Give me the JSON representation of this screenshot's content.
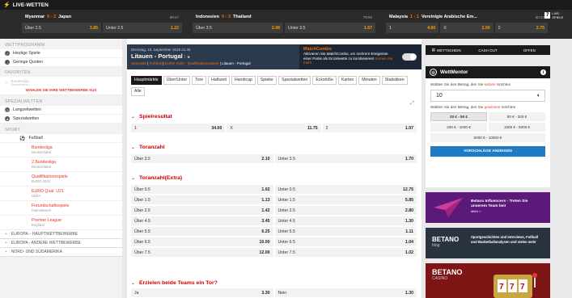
{
  "topbar": {
    "title": "LIVE-WETTEN",
    "live_label": "LIVE-SPIELE",
    "live_count": "7"
  },
  "live_games": [
    {
      "home": "Myanmar",
      "score": "0 - 2",
      "away": "Japan",
      "time": "89:47",
      "odds": [
        {
          "label": "Über 2.5",
          "value": "3.85"
        },
        {
          "label": "Unter 2.5",
          "value": "1.22"
        }
      ]
    },
    {
      "home": "Indonesien",
      "score": "0 - 3",
      "away": "Thailand",
      "time": "79:50",
      "odds": [
        {
          "label": "Über 3.5",
          "value": "2.08"
        },
        {
          "label": "Unter 3.5",
          "value": "1.67"
        }
      ]
    },
    {
      "home": "Malaysia",
      "score": "1 - 1",
      "away": "Vereinigte Arabische Em...",
      "time": "60:43",
      "odds": [
        {
          "label": "1",
          "value": "4.60"
        },
        {
          "label": "X",
          "value": "2.00"
        },
        {
          "label": "2",
          "value": "2.75"
        }
      ]
    }
  ],
  "sidebar": {
    "section1": "WETTPROGRAMM",
    "items1": [
      "Heutige Spiele",
      "Geringe Quoten"
    ],
    "section2": "FAVORITEN",
    "fav_item": {
      "name": "Bundesliga",
      "sub": "Deutschland"
    },
    "fav_msg": "WÄHLEN SIE IHRE WETTBEWERBE AUS",
    "section3": "SPEZIALWETTEN",
    "items3": [
      "Langzeitwetten",
      "Spezialwetten"
    ],
    "section4": "SPORT",
    "sport": "Fußball",
    "leagues": [
      {
        "name": "Bundesliga",
        "country": "Deutschland"
      },
      {
        "name": "2 Bundesliga",
        "country": "Deutschland"
      },
      {
        "name": "Qualifikationsspiele",
        "country": "EURO 2020"
      },
      {
        "name": "EURO Qual. U21",
        "country": "UEFA"
      },
      {
        "name": "Freundschaftsspiele",
        "country": "International"
      },
      {
        "name": "Premier League",
        "country": "England"
      }
    ],
    "categories": [
      "EUROPA – HAUPTWETTBEWERBE",
      "EUROPA - ANDERE WETTBEWERBE",
      "NORD- UND SÜDAMERIKA"
    ]
  },
  "event": {
    "date": "Dienstag, 10. September 2019 21:45",
    "title": "Litauen - Portugal",
    "breadcrumb": [
      "Startseite",
      "Fußball",
      "EURO 2020 - Qualifikationsspiele",
      "Litauen - Portugal"
    ]
  },
  "matchcombo": {
    "title": "MatchCombo",
    "desc": "Aktivieren Sie MatchCombo, um mehrere Ereignisse einer Partie als Einzelwette zu kombinieren!",
    "link": "Lernen Sie mehr"
  },
  "tabs": [
    "Hauptmärkte",
    "Über/Unter",
    "Tore",
    "Halbzeit",
    "Handicap",
    "Spieler",
    "Spezialwetten",
    "Eckstöße",
    "Karten",
    "Minuten",
    "Statistiken",
    "Alle"
  ],
  "markets": {
    "m1": {
      "title": "Spielresultat",
      "odds": [
        [
          "1",
          "34.00"
        ],
        [
          "X",
          "11.75"
        ],
        [
          "2",
          "1.07"
        ]
      ]
    },
    "m2": {
      "title": "Toranzahl",
      "odds": [
        [
          "Über 3.5",
          "2.10"
        ],
        [
          "Unter 3.5",
          "1.70"
        ]
      ]
    },
    "m3": {
      "title": "Toranzahl(Extra)",
      "rows": [
        [
          [
            "Über 0.5",
            "1.02"
          ],
          [
            "Unter 0.5",
            "12.75"
          ]
        ],
        [
          [
            "Über 1.5",
            "1.13"
          ],
          [
            "Unter 1.5",
            "5.85"
          ]
        ],
        [
          [
            "Über 2.5",
            "1.42"
          ],
          [
            "Unter 2.5",
            "2.80"
          ]
        ],
        [
          [
            "Über 4.5",
            "3.45"
          ],
          [
            "Unter 4.5",
            "1.30"
          ]
        ],
        [
          [
            "Über 5.5",
            "6.25"
          ],
          [
            "Unter 5.5",
            "1.11"
          ]
        ],
        [
          [
            "Über 6.5",
            "10.00"
          ],
          [
            "Unter 6.5",
            "1.04"
          ]
        ],
        [
          [
            "Über 7.5",
            "12.00"
          ],
          [
            "Unter 7.5",
            "1.02"
          ]
        ]
      ]
    },
    "m4": {
      "title": "Erzielen beide Teams ein Tor?",
      "odds": [
        [
          "Ja",
          "3.30"
        ],
        [
          "Nein",
          "1.30"
        ]
      ]
    }
  },
  "right_tabs": [
    "WETTSCHEIN",
    "CASH OUT",
    "OFFEN"
  ],
  "wettmentor": {
    "title": "WettMentor",
    "label1_pre": "Wählen Sie den Betrag, den Sie",
    "label1_em": "setzen",
    "label1_post": "möchten",
    "amount": "10",
    "label2_pre": "Wählen Sie den Betrag, den Sie",
    "label2_em": "gewinnen",
    "label2_post": "möchten",
    "options": [
      "20 € - 50 €",
      "50 € - 200 €",
      "200 € - 1000 €",
      "1000 € - 5000 €",
      "5000 € - 10000 €"
    ],
    "submit": "VORSCHLÄGE ANZEIGEN"
  },
  "promos": [
    {
      "text": "Betano Influencers - Treten Sie unserem Team bei!",
      "sub": "Mehr >"
    },
    {
      "logo": "BETANO",
      "logo_sub": "blog",
      "text": "Sportgeschichten und Interviews, Fußball und Basketballanalysen und vieles mehr"
    },
    {
      "logo": "BETANO",
      "logo_sub": "CASINO"
    }
  ],
  "colors": {
    "accent": "#f06d00",
    "red": "#cc0000",
    "blue": "#1e7bc4",
    "dark": "#1a1a1a"
  }
}
